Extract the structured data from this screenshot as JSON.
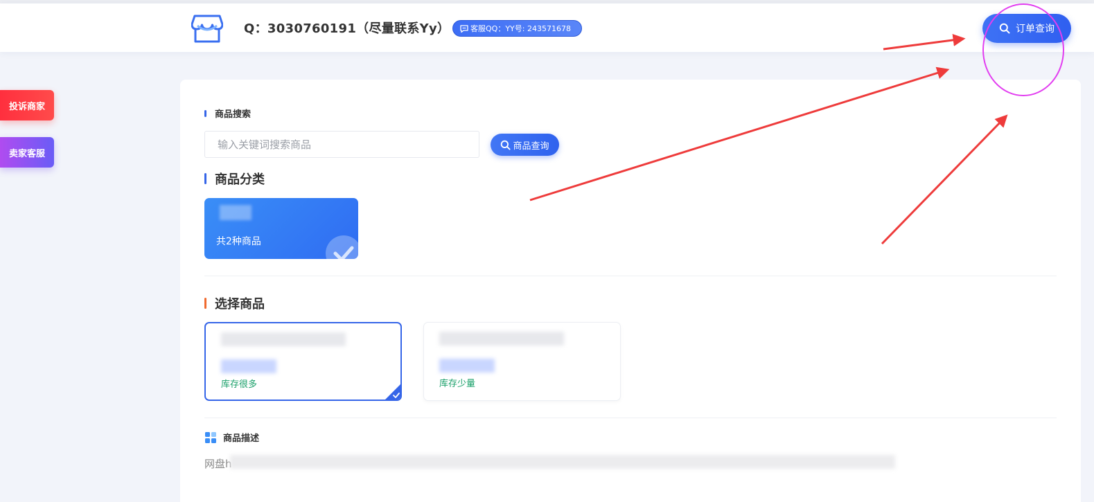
{
  "header": {
    "contact_text": "Q：3030760191（尽量联系Yy）",
    "qq_badge": "客服QQ：YY号: 243571678",
    "order_query_label": "订单查询"
  },
  "side": {
    "complain_label": "投诉商家",
    "service_label": "卖家客服"
  },
  "search": {
    "section_title": "商品搜索",
    "placeholder": "输入关键词搜索商品",
    "button_label": "商品查询"
  },
  "category": {
    "section_title": "商品分类",
    "card": {
      "count_label": "共2种商品"
    }
  },
  "products": {
    "section_title": "选择商品",
    "items": [
      {
        "stock_label": "库存很多",
        "selected": true
      },
      {
        "stock_label": "库存少量",
        "selected": false
      }
    ]
  },
  "description": {
    "section_title": "商品描述",
    "text_prefix": "网盘h"
  },
  "colors": {
    "accent": "#3565e8",
    "complain": "#ff2f3e",
    "service": "#8d54f3",
    "annotation_arrow": "#ee3b3b",
    "annotation_circle": "#e23ef0",
    "stock_green": "#1aa06a"
  },
  "icons": [
    "shop-logo-icon",
    "chat-icon",
    "search-icon",
    "check-icon",
    "grid-icon"
  ]
}
